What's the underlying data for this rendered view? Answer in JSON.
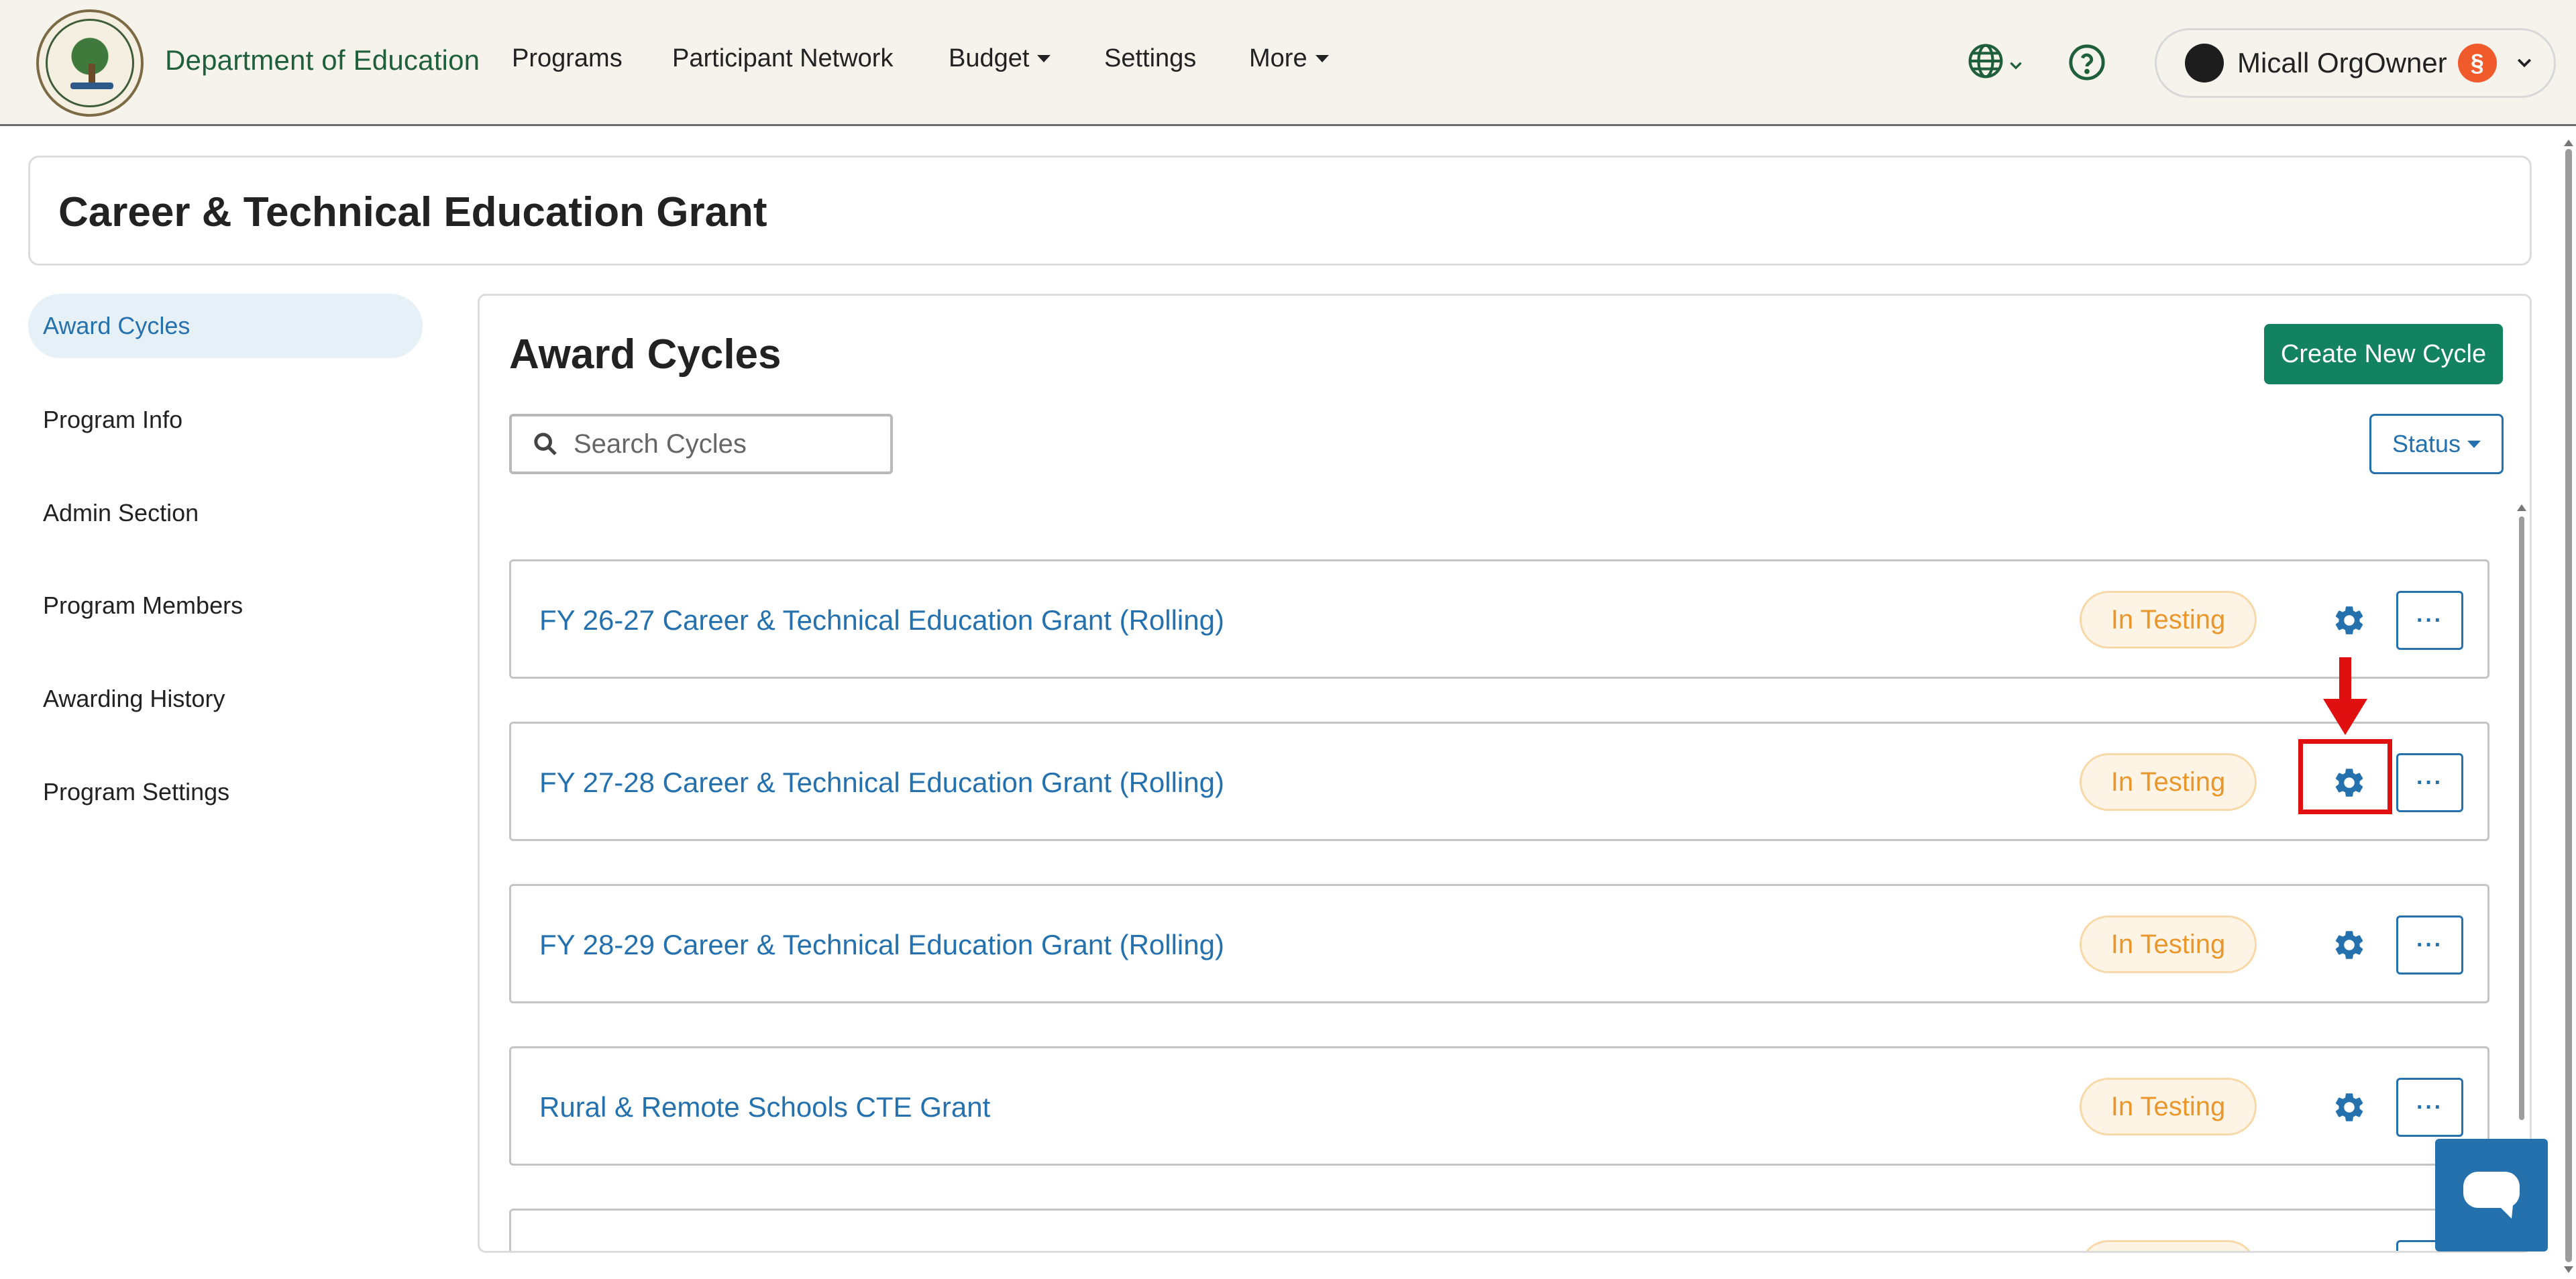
{
  "nav": {
    "org_name": "Department of Education",
    "items": [
      {
        "label": "Programs"
      },
      {
        "label": "Participant Network"
      },
      {
        "label": "Budget"
      },
      {
        "label": "Settings"
      },
      {
        "label": "More"
      }
    ],
    "user_name": "Micall OrgOwner",
    "user_badge": "§",
    "icons": [
      "globe-icon",
      "help-icon",
      "chevron-down-icon"
    ]
  },
  "program": {
    "title": "Career & Technical Education Grant"
  },
  "sidebar": {
    "items": [
      {
        "label": "Award Cycles",
        "active": true
      },
      {
        "label": "Program Info"
      },
      {
        "label": "Admin Section"
      },
      {
        "label": "Program Members"
      },
      {
        "label": "Awarding History"
      },
      {
        "label": "Program Settings"
      }
    ]
  },
  "main": {
    "title": "Award Cycles",
    "create_button": "Create New Cycle",
    "search_placeholder": "Search Cycles",
    "status_filter": "Status",
    "cycles": [
      {
        "name": "FY 26-27 Career & Technical Education Grant (Rolling)",
        "status": "In Testing",
        "more": "···"
      },
      {
        "name": "FY 27-28 Career & Technical Education Grant (Rolling)",
        "status": "In Testing",
        "more": "···"
      },
      {
        "name": "FY 28-29 Career & Technical Education Grant (Rolling)",
        "status": "In Testing",
        "more": "···"
      },
      {
        "name": "Rural & Remote Schools CTE Grant",
        "status": "In Testing",
        "more": "···"
      },
      {
        "name": "",
        "status": "",
        "more": "···"
      }
    ]
  },
  "colors": {
    "accent_blue": "#2571ad",
    "primary_green": "#128261",
    "status_orange": "#e9972b",
    "annotation_red": "#e01010",
    "nav_background": "#f6f3ec"
  }
}
